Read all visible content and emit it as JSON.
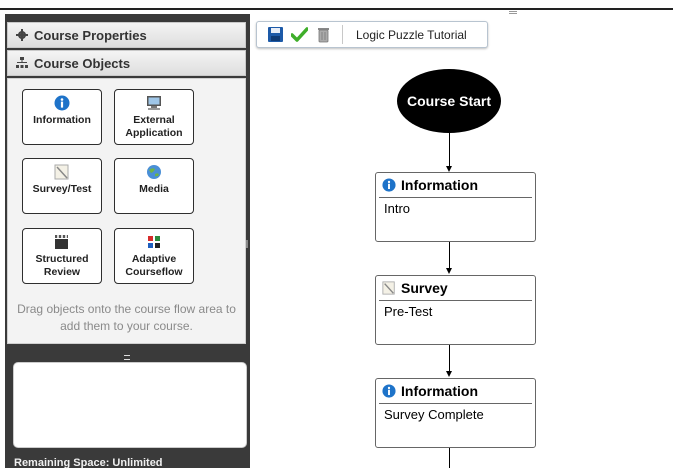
{
  "left_panel": {
    "course_properties_label": "Course Properties",
    "course_objects_label": "Course Objects",
    "objects": [
      {
        "label_line1": "Information",
        "label_line2": "",
        "icon": "info-icon"
      },
      {
        "label_line1": "External",
        "label_line2": "Application",
        "icon": "computer-icon"
      },
      {
        "label_line1": "Survey/Test",
        "label_line2": "",
        "icon": "survey-icon"
      },
      {
        "label_line1": "Media",
        "label_line2": "",
        "icon": "globe-icon"
      },
      {
        "label_line1": "Structured",
        "label_line2": "Review",
        "icon": "clapperboard-icon"
      },
      {
        "label_line1": "Adaptive",
        "label_line2": "Courseflow",
        "icon": "grid-icon"
      }
    ],
    "drag_hint": "Drag objects onto the course flow area to add them to your course.",
    "remaining_space": "Remaining Space: Unlimited"
  },
  "toolbar": {
    "course_title": "Logic Puzzle Tutorial",
    "icons": [
      "save-icon",
      "check-icon",
      "trash-icon"
    ]
  },
  "flow": {
    "start_label": "Course Start",
    "nodes": [
      {
        "type": "Information",
        "name": "Intro",
        "icon": "info-icon"
      },
      {
        "type": "Survey",
        "name": "Pre-Test",
        "icon": "survey-icon"
      },
      {
        "type": "Information",
        "name": "Survey Complete",
        "icon": "info-icon"
      }
    ]
  },
  "colors": {
    "panel_bg": "#3a3a3a",
    "info_blue": "#1e73c9",
    "check_green": "#3fae2a"
  }
}
